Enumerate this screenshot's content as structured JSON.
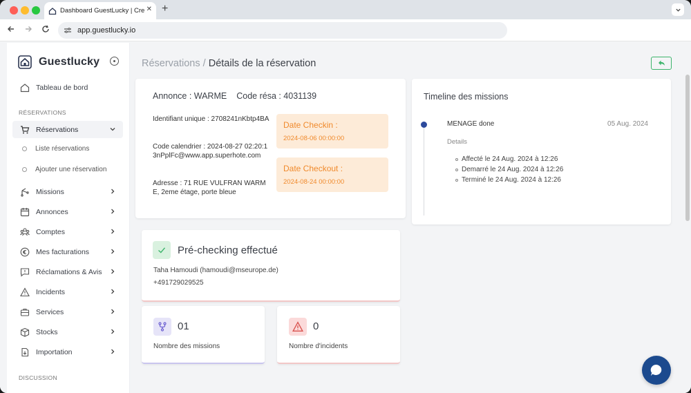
{
  "browser": {
    "tab_title": "Dashboard GuestLucky | Cre",
    "tab_close": "✕",
    "new_tab": "+",
    "url": "app.guestlucky.io"
  },
  "sidebar": {
    "brand": "Guestlucky",
    "dashboard": "Tableau de bord",
    "section_reservations": "RÉSERVATIONS",
    "reservations": "Réservations",
    "sub_list": "Liste réservations",
    "sub_add": "Ajouter une réservation",
    "items": [
      "Missions",
      "Annonces",
      "Comptes",
      "Mes facturations",
      "Réclamations & Avis",
      "Incidents",
      "Services",
      "Stocks",
      "Importation"
    ],
    "section_discussion": "DISCUSSION"
  },
  "breadcrumb": {
    "parent": "Réservations / ",
    "current": "Détails de la réservation"
  },
  "reservation": {
    "annonce": "Annonce : WARME",
    "code": "Code résa : 4031139",
    "identifiant": "Identifiant unique : 2708241nKbtp4BA",
    "calendrier": "Code calendrier : 2024-08-27 02:20:13nPplFc@www.app.superhote.com",
    "adresse": "Adresse : 71 RUE VULFRAN WARME, 2eme étage, porte bleue",
    "checkin_label": "Date Checkin :",
    "checkin_value": "2024-08-06 00:00:00",
    "checkout_label": "Date Checkout :",
    "checkout_value": "2024-08-24 00:00:00"
  },
  "timeline": {
    "title": "Timeline des missions",
    "mission_name": "MENAGE done",
    "mission_date": "05 Aug. 2024",
    "details_label": "Details",
    "steps": [
      "Affecté le 24 Aug. 2024 à 12:26",
      "Demarré le 24 Aug. 2024 à 12:26",
      "Terminé le 24 Aug. 2024 à 12:26"
    ]
  },
  "precheck": {
    "title": "Pré-checking effectué",
    "guest": "Taha Hamoudi (hamoudi@mseurope.de)",
    "phone": "+491729029525"
  },
  "stats": {
    "missions_count": "01",
    "missions_label": "Nombre des missions",
    "incidents_count": "0",
    "incidents_label": "Nombre d'incidents"
  },
  "colors": {
    "accent_green": "#3cb46b",
    "checkin_orange": "#f08a2c",
    "timeline_dot": "#2c4a9c",
    "chat_blue": "#1c4a8e"
  }
}
